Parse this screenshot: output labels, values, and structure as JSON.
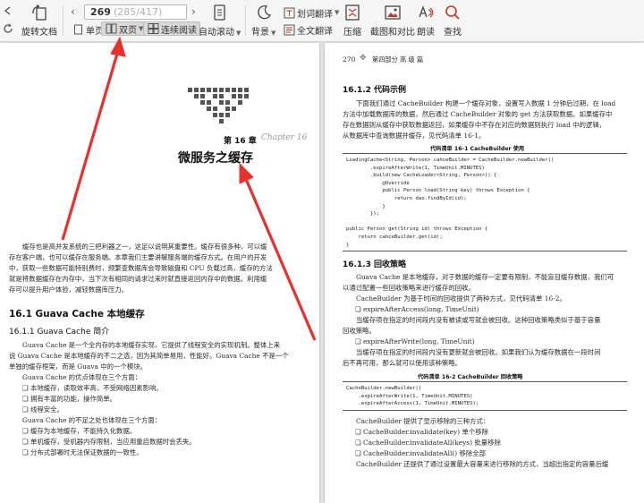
{
  "toolbar": {
    "rotate_label": "旋转文档",
    "single_label": "单页",
    "double_label": "双页",
    "continuous_label": "连续阅读",
    "autoscroll_label": "自动滚动",
    "background_label": "背景",
    "word_translate_label": "划词翻译",
    "full_translate_label": "全文翻译",
    "compress_label": "压缩",
    "screenshot_label": "截图和对比",
    "read_aloud_label": "朗读",
    "search_label": "查找",
    "page_current": "269",
    "page_total": "(285/417)"
  },
  "colors": {
    "arrow": "#e8302c",
    "toolbar_bg": "#f5f5f5"
  },
  "left_page": {
    "chapter_label": "第 16 章",
    "chapter_script": "Chapter 16",
    "chapter_title": "微服务之缓存",
    "intro": [
      "缓存也是高并发系统的三把利器之一，这足以说明其重要性。缓存有很多种，可以缓",
      "存在客户端，也可以缓存在服务端。本章我们主要讲解服务端的缓存方式。在用户的开发",
      "中，获取一些数据可能特别费时，频繁查数据库会导致磁盘和 CPU 负载过高，缓存的方法",
      "就是将数据缓存在内存中，当下次有相同的请求过来时就直接返回内存中的数据。利用缓",
      "存可以提升用户体验，减轻数据库压力。"
    ],
    "section": "16.1   Guava Cache 本地缓存",
    "subsection": "16.1.1    Guava Cache 简介",
    "para1": [
      "Guava Cache 是一个全内存的本地缓存实现，它提供了线程安全的实现机制。整体上来",
      "说 Guava Cache 是本地缓存的不二之选，因为其简单易用，性能好。Guava Cache 不是一个",
      "单独的缓存框架，而是 Guava 中的一个模块。"
    ],
    "adv_title": "Guava Cache 的优点体现在三个方面：",
    "adv": [
      "❏ 本地缓存，读取效率高，不受网络因素影响。",
      "❏ 拥有丰富的功能，操作简单。",
      "❏ 线程安全。"
    ],
    "dis_title": "Guava Cache 的不足之处也体现在三个方面：",
    "dis": [
      "❏ 缓存为本地缓存，不能持久化数据。",
      "❏ 单机缓存，受机器内存限制，当应用重启数据时会丢失。",
      "❏ 分布式部署时无法保证数据的一致性。"
    ]
  },
  "right_page": {
    "header_num": "270",
    "header_part": "第四部分   高   级   篇",
    "s1": "16.1.2    代码示例",
    "s1_para": [
      "下面我们通过 CacheBuilder 构建一个缓存对象，设置写入数据 1 分钟后过期，在 load",
      "方法中加载数据库的数据，然后通过 CacheBuilder 对象的 get 方法获取数据。如果缓存中",
      "存在数据则从缓存中获取数据返回，如果缓存中不存在对应的数据则执行 load 中的逻辑，",
      "从数据库中查询数据并缓存，见代码清单 16-1。"
    ],
    "code1_caption": "代码清单 16-1    CacheBuilder 使用",
    "code1": [
      "LoadingCache<String, Person> cahceBuilder = CacheBuilder.newBuilder()",
      "        .expireAfterWrite(1, TimeUnit.MINUTES)",
      "        .build(new CacheLoader<String, Person>() {",
      "            @Override",
      "            public Person load(String key) throws Exception {",
      "                return dao.findById(id);",
      "            }",
      "        });",
      "",
      "public Person get(String id) throws Exception {",
      "    return cahceBuilder.get(id);",
      "}"
    ],
    "s2": "16.1.3    回收策略",
    "s2_para": [
      "Guava Cache 是本地缓存，对于数据的缓存一定要有限制，不能盲目缓存数据，我们可",
      "以通过配置一些回收策略来进行缓存的回收。"
    ],
    "s2_line": "CacheBuilder 为基于时间的回收提供了两种方式，见代码清单 16-2。",
    "opt1": "❏ expireAfterAccess(long, TimeUnit)",
    "opt1_desc": [
      "当缓存项在指定的时间段内没有被读或写就会被回收。这种回收策略类似于基于容量",
      "回收策略。"
    ],
    "opt2": "❏ expireAfterWrite(long, TimeUnit)",
    "opt2_desc": [
      "当缓存项在指定的时间段内没有更新就会被回收。如果我们认为缓存数据在一段时间",
      "后不再可用，那么就可以使用该种策略。"
    ],
    "code2_caption": "代码清单 16-2    CacheBuilder 回收策略",
    "code2": [
      "CacheBuilder.newBuilder()",
      "    .expireAfterWrite(1, TimeUnit.MINUTES)",
      "    .expireAfterAccess(1, TimeUnit.MINUTES);"
    ],
    "rm_title": "CacheBuilder 提供了显示移除的三种方式：",
    "rm": [
      "❏ CacheBuilder.invalidate(key) 单个移除",
      "❏ CacheBuilder.invalidateAll(keys) 批量移除",
      "❏ CacheBuilder.invalidateAll() 移除全部"
    ],
    "last": "CacheBuilder 还提供了通过设置最大容量来进行移除的方式，当超出指定的容量后缓"
  }
}
